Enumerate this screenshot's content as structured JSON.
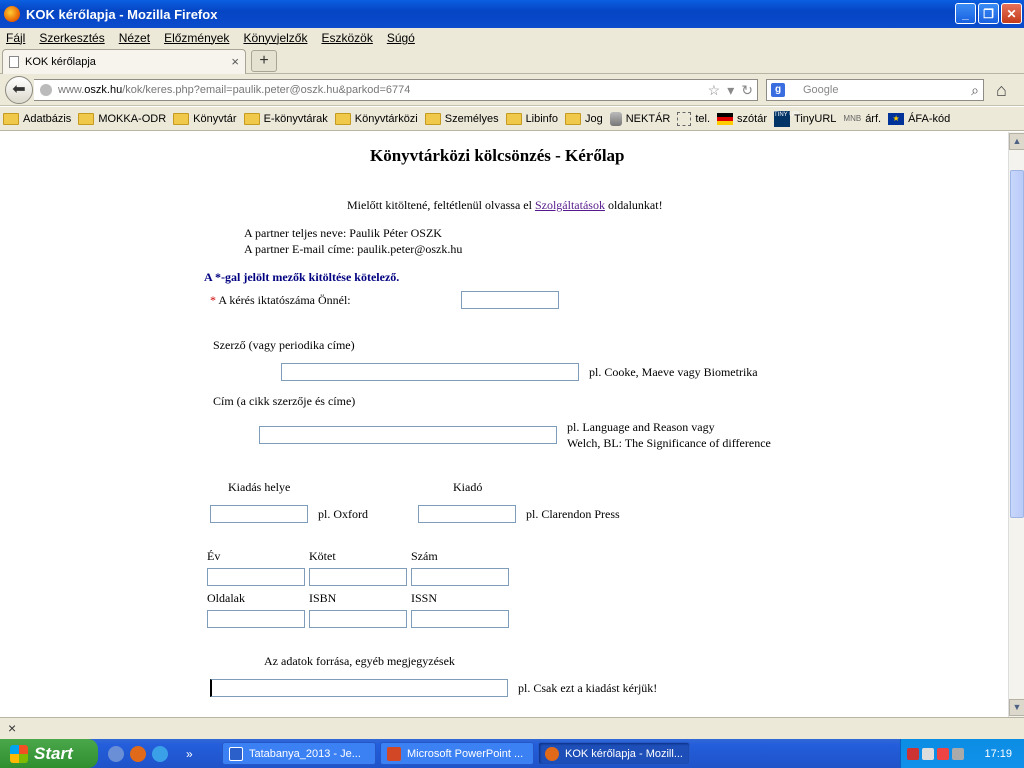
{
  "window": {
    "title": "KOK kérőlapja - Mozilla Firefox"
  },
  "menu": [
    "Fájl",
    "Szerkesztés",
    "Nézet",
    "Előzmények",
    "Könyvjelzők",
    "Eszközök",
    "Súgó"
  ],
  "tab": {
    "label": "KOK kérőlapja"
  },
  "nav": {
    "url_prefix": "www.",
    "url_domain": "oszk.hu",
    "url_path": "/kok/keres.php?email=paulik.peter@oszk.hu&parkod=6774",
    "search_placeholder": "Google"
  },
  "bookmarks": [
    "Adatbázis",
    "MOKKA-ODR",
    "Könyvtár",
    "E-könyvtárak",
    "Könyvtárközi",
    "Személyes",
    "Libinfo",
    "Jog",
    "NEKTÁR",
    "tel.",
    "szótár",
    "TinyURL",
    "árf.",
    "ÁFA-kód"
  ],
  "page": {
    "title": "Könyvtárközi kölcsönzés - Kérőlap",
    "intro_before": "Mielőtt kitöltené, feltétlenül olvassa el ",
    "intro_link": "Szolgáltatások",
    "intro_after": " oldalunkat!",
    "partner_name": "A partner teljes neve: Paulik Péter OSZK",
    "partner_email": "A partner E-mail címe: paulik.peter@oszk.hu",
    "required_note": "A *-gal jelölt mezők kitöltése kötelező.",
    "star": "*",
    "label_iktato": "A kérés iktatószáma Önnél:",
    "label_szerzo": "Szerző (vagy periodika címe)",
    "hint_szerzo": "pl. Cooke, Maeve vagy Biometrika",
    "label_cim": "Cím (a cikk szerzője és címe)",
    "hint_cim_1": "pl. Language and Reason vagy",
    "hint_cim_2": "Welch, BL: The Significance of difference",
    "label_kiadas_helye": "Kiadás helye",
    "label_kiado": "Kiadó",
    "hint_kiadas_helye": "pl. Oxford",
    "hint_kiado": "pl. Clarendon Press",
    "label_ev": "Év",
    "label_kotet": "Kötet",
    "label_szam": "Szám",
    "label_oldalak": "Oldalak",
    "label_isbn": "ISBN",
    "label_issn": "ISSN",
    "label_forras": "Az adatok forrása, egyéb megjegyzések",
    "hint_forras": "pl. Csak ezt a kiadást kérjük!"
  },
  "taskbar": {
    "start": "Start",
    "tasks": [
      "Tatabanya_2013 - Je...",
      "Microsoft PowerPoint ...",
      "KOK kérőlapja - Mozill..."
    ],
    "clock": "17:19"
  }
}
